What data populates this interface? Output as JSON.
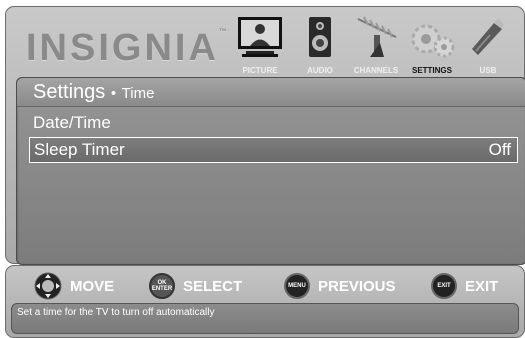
{
  "brand": {
    "name": "INSIGNIA",
    "tm": "™"
  },
  "tabs": [
    {
      "label": "PICTURE",
      "icon": "tv-picture-icon",
      "active": false
    },
    {
      "label": "AUDIO",
      "icon": "speaker-icon",
      "active": false
    },
    {
      "label": "CHANNELS",
      "icon": "antenna-icon",
      "active": false
    },
    {
      "label": "SETTINGS",
      "icon": "gears-icon",
      "active": true
    },
    {
      "label": "USB",
      "icon": "usb-stick-icon",
      "active": false
    }
  ],
  "menu": {
    "title": "Settings",
    "separator": "•",
    "subtitle": "Time",
    "items": [
      {
        "label": "Date/Time",
        "value": ""
      },
      {
        "label": "Sleep Timer",
        "value": "Off"
      }
    ]
  },
  "nav": {
    "move": "MOVE",
    "select": "SELECT",
    "previous": "PREVIOUS",
    "exit": "EXIT",
    "ok_top": "OK",
    "ok_bottom": "ENTER",
    "menu_btn": "MENU",
    "exit_btn": "EXIT"
  },
  "help_text": "Set a time for the TV to turn off automatically"
}
